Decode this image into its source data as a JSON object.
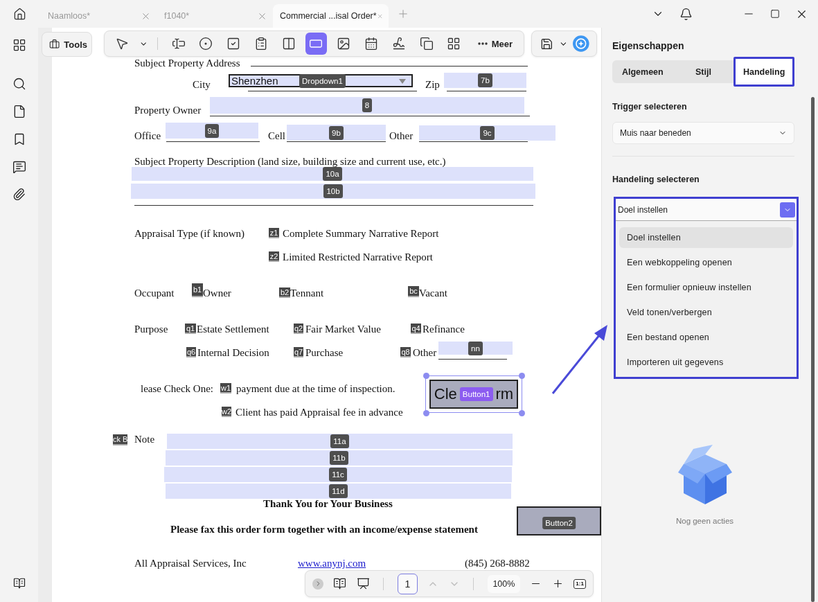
{
  "tabs": [
    {
      "label": "Naamloos*",
      "selected": false
    },
    {
      "label": "f1040*",
      "selected": false
    },
    {
      "label": "Commercial ...isal Order*",
      "selected": true
    }
  ],
  "toolbar": {
    "tools_label": "Tools",
    "more_label": "Meer",
    "tools": [
      {
        "kind": "pointer",
        "selected": false
      },
      {
        "kind": "text-field",
        "selected": false
      },
      {
        "kind": "radio",
        "selected": false
      },
      {
        "kind": "checkbox",
        "selected": false
      },
      {
        "kind": "combo",
        "selected": false
      },
      {
        "kind": "listbox",
        "selected": false
      },
      {
        "kind": "button",
        "selected": true
      },
      {
        "kind": "image",
        "selected": false
      },
      {
        "kind": "date",
        "selected": false
      },
      {
        "kind": "signature",
        "selected": false
      },
      {
        "kind": "copy",
        "selected": false
      },
      {
        "kind": "grid",
        "selected": false
      }
    ]
  },
  "document": {
    "items": [
      {
        "kind": "text",
        "text": "Subject Property Address"
      },
      {
        "kind": "text",
        "text": "City"
      },
      {
        "kind": "dropdown",
        "value": "Shenzhen",
        "tag": "Dropdown1"
      },
      {
        "kind": "text",
        "text": "Zip"
      },
      {
        "kind": "field",
        "tag": "7b"
      },
      {
        "kind": "text",
        "text": "Property Owner"
      },
      {
        "kind": "field",
        "tag": "8"
      },
      {
        "kind": "text",
        "text": "Office"
      },
      {
        "kind": "field",
        "tag": "9a"
      },
      {
        "kind": "text",
        "text": "Cell"
      },
      {
        "kind": "field",
        "tag": "9b"
      },
      {
        "kind": "text",
        "text": "Other"
      },
      {
        "kind": "field",
        "tag": "9c"
      },
      {
        "kind": "text",
        "text": "Subject Property Description (land size, building size and current use, etc.)"
      },
      {
        "kind": "field",
        "tag": "10a"
      },
      {
        "kind": "field",
        "tag": "10b"
      },
      {
        "kind": "text",
        "text": "Appraisal Type (if known)"
      },
      {
        "kind": "checkbox",
        "tag": "z1"
      },
      {
        "kind": "text",
        "text": "Complete Summary Narrative Report"
      },
      {
        "kind": "checkbox",
        "tag": "z2"
      },
      {
        "kind": "text",
        "text": "Limited Restricted Narrative Report"
      },
      {
        "kind": "text",
        "text": "Occupant"
      },
      {
        "kind": "checkbox",
        "tag": "b1"
      },
      {
        "kind": "text",
        "text": "Owner"
      },
      {
        "kind": "checkbox",
        "tag": "b2"
      },
      {
        "kind": "text",
        "text": "Tennant"
      },
      {
        "kind": "checkbox",
        "tag": "bc"
      },
      {
        "kind": "text",
        "text": "Vacant"
      },
      {
        "kind": "text",
        "text": "Purpose"
      },
      {
        "kind": "checkbox",
        "tag": "q1"
      },
      {
        "kind": "text",
        "text": "Estate Settlement"
      },
      {
        "kind": "checkbox",
        "tag": "q2"
      },
      {
        "kind": "text",
        "text": "Fair Market Value"
      },
      {
        "kind": "checkbox",
        "tag": "q4"
      },
      {
        "kind": "text",
        "text": "Refinance"
      },
      {
        "kind": "checkbox",
        "tag": "q6"
      },
      {
        "kind": "text",
        "text": "Internal Decision"
      },
      {
        "kind": "checkbox",
        "tag": "q7"
      },
      {
        "kind": "text",
        "text": "Purchase"
      },
      {
        "kind": "checkbox",
        "tag": "q8"
      },
      {
        "kind": "text",
        "text": "Other"
      },
      {
        "kind": "field",
        "tag": "nn"
      },
      {
        "kind": "text",
        "text": "lease Check One:"
      },
      {
        "kind": "checkbox",
        "tag": "w1"
      },
      {
        "kind": "text",
        "text": "payment due at the time of inspection."
      },
      {
        "kind": "checkbox",
        "tag": "w2"
      },
      {
        "kind": "text",
        "text": "Client has paid Appraisal fee in advance"
      },
      {
        "kind": "button",
        "label_parts": [
          "Cle",
          "rm"
        ],
        "tag": "Button1",
        "selected": true
      },
      {
        "kind": "checkbox",
        "tag": "ck B"
      },
      {
        "kind": "text",
        "text": "Note"
      },
      {
        "kind": "field",
        "tag": "11a"
      },
      {
        "kind": "field",
        "tag": "11b"
      },
      {
        "kind": "field",
        "tag": "11c"
      },
      {
        "kind": "field",
        "tag": "11d"
      },
      {
        "kind": "heading",
        "text": "Thank You for Your Business"
      },
      {
        "kind": "button",
        "tag": "Button2",
        "selected": false
      },
      {
        "kind": "heading",
        "text": "Please fax this order form together with an income/expense statement"
      },
      {
        "kind": "text",
        "text": "All Appraisal Services, Inc"
      },
      {
        "kind": "link",
        "text": "www.anynj.com"
      },
      {
        "kind": "text",
        "text": "(845) 268-8882"
      }
    ]
  },
  "bottom_bar": {
    "page": "1",
    "zoom": "100%",
    "fit_label": "1:1"
  },
  "panel": {
    "title": "Eigenschappen",
    "tabs": [
      {
        "label": "Algemeen",
        "selected": false
      },
      {
        "label": "Stijl",
        "selected": false
      },
      {
        "label": "Handeling",
        "selected": true
      }
    ],
    "trigger_label": "Trigger selecteren",
    "trigger_value": "Muis naar beneden",
    "action_label": "Handeling selecteren",
    "action_value": "Doel instellen",
    "options": [
      {
        "label": "Doel instellen",
        "selected": true
      },
      {
        "label": "Een webkoppeling openen",
        "selected": false
      },
      {
        "label": "Een formulier opnieuw instellen",
        "selected": false
      },
      {
        "label": "Veld tonen/verbergen",
        "selected": false
      },
      {
        "label": "Een bestand openen",
        "selected": false
      },
      {
        "label": "Importeren uit gegevens",
        "selected": false
      }
    ],
    "empty_text": "Nog geen acties"
  }
}
